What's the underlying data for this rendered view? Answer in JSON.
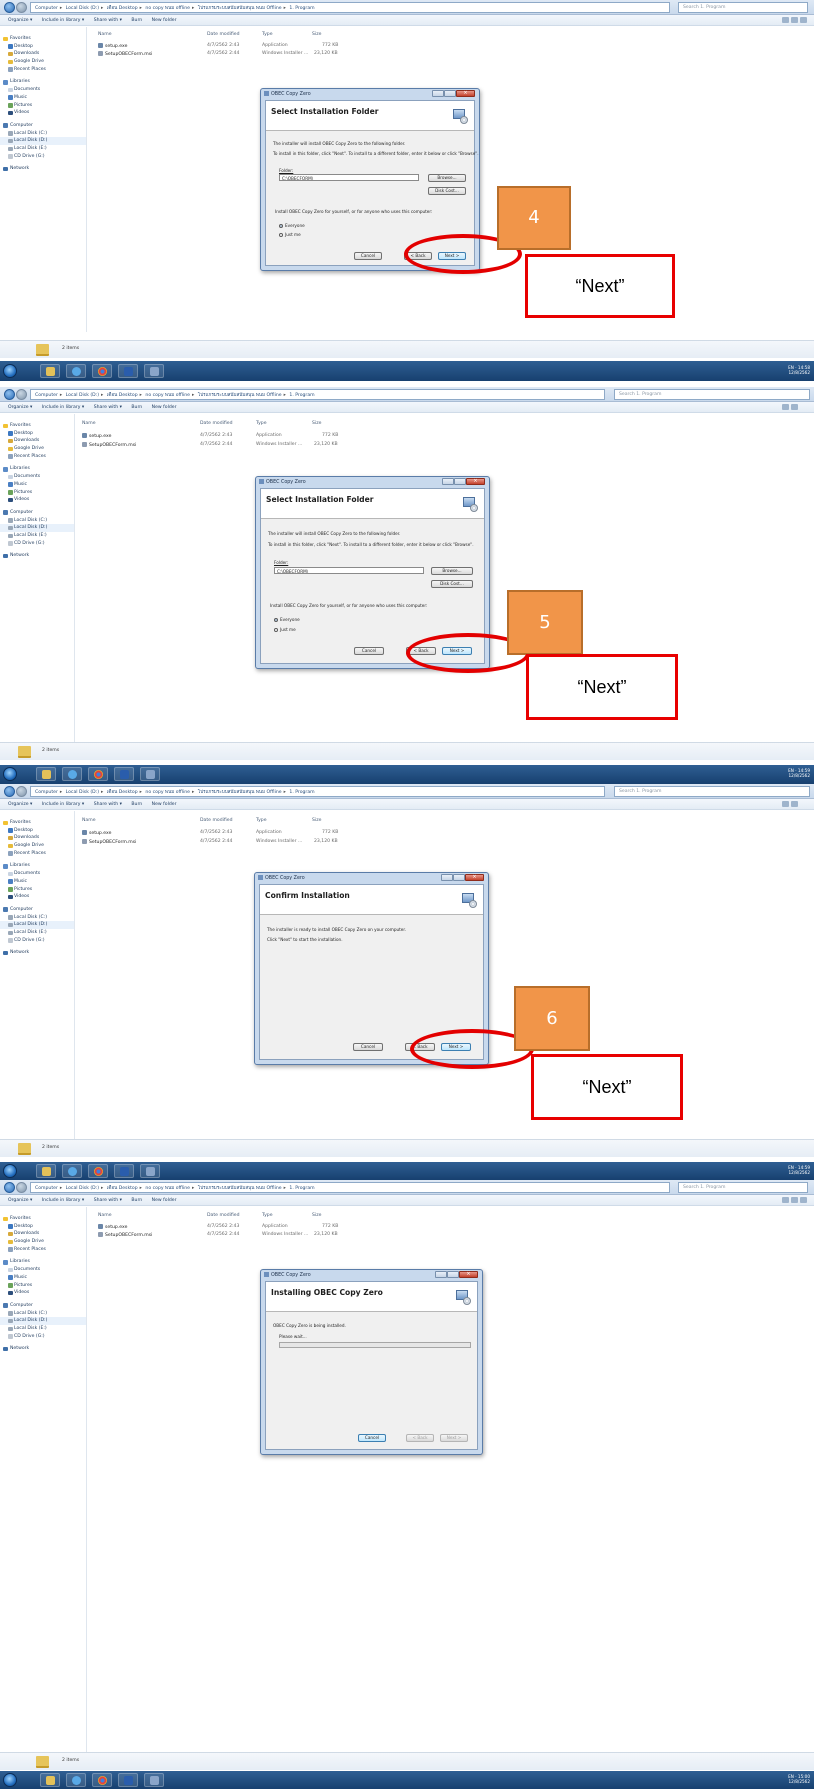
{
  "explorer": {
    "breadcrumb": [
      "Computer",
      "Local Disk (D:)",
      "เดือน Desktop",
      "no copy พนม offline",
      "โปรแกรมระบบสนับสนับสนุน พนม Offline",
      "1. Program"
    ],
    "search_placeholder": "Search 1. Program",
    "toolbar": [
      "Organize ▾",
      "Include in library ▾",
      "Share with ▾",
      "Burn",
      "New folder"
    ],
    "nav": {
      "favorites": "Favorites",
      "favorite_items": [
        "Desktop",
        "Downloads",
        "Google Drive",
        "Recent Places"
      ],
      "libraries": "Libraries",
      "library_items": [
        "Documents",
        "Music",
        "Pictures",
        "Videos"
      ],
      "computer": "Computer",
      "computer_items": [
        "Local Disk (C:)",
        "Local Disk (D:)",
        "Local Disk (E:)",
        "CD Drive (G:)"
      ],
      "network": "Network"
    },
    "columns": {
      "name": "Name",
      "date": "Date modified",
      "type": "Type",
      "size": "Size"
    },
    "files": [
      {
        "name": "setup.exe",
        "date": "4/7/2562 2:43",
        "type": "Application",
        "size": "772 KB"
      },
      {
        "name": "SetupOBECForm.msi",
        "date": "4/7/2562 2:44",
        "type": "Windows Installer ...",
        "size": "23,120 KB"
      }
    ],
    "item_count": "2 items"
  },
  "taskbar": {
    "language": "EN",
    "times": [
      "14:58",
      "14:59",
      "14:59",
      "15:00"
    ],
    "date": "12/8/2562"
  },
  "dialog": {
    "window_title": "OBEC Copy Zero",
    "select_folder": {
      "heading": "Select Installation Folder",
      "line1": "The installer will install OBEC Copy Zero to the following folder.",
      "line2": "To install in this folder, click \"Next\". To install to a different folder, enter it below or click \"Browse\".",
      "folder_label": "Folder:",
      "folder_value": "C:\\OBECFORM\\",
      "browse": "Browse...",
      "disk_cost": "Disk Cost...",
      "for_whom": "Install OBEC Copy Zero for yourself, or for anyone who uses this computer:",
      "everyone": "Everyone",
      "just_me": "Just me"
    },
    "confirm": {
      "heading": "Confirm Installation",
      "line1": "The installer is ready to install OBEC Copy Zero on your computer.",
      "line2": "Click \"Next\" to start the installation."
    },
    "installing": {
      "heading": "Installing OBEC Copy Zero",
      "line1": "OBEC Copy Zero is being installed.",
      "wait": "Please wait...",
      "progress": 0.0
    },
    "buttons": {
      "cancel": "Cancel",
      "back": "< Back",
      "next": "Next >"
    }
  },
  "steps": [
    {
      "number": "4",
      "label": "“Next”"
    },
    {
      "number": "5",
      "label": "“Next”"
    },
    {
      "number": "6",
      "label": "“Next”"
    }
  ],
  "colors": {
    "step_fill": "#f19549",
    "callout_border": "#e80000",
    "taskbar": "#1f4a7d"
  }
}
